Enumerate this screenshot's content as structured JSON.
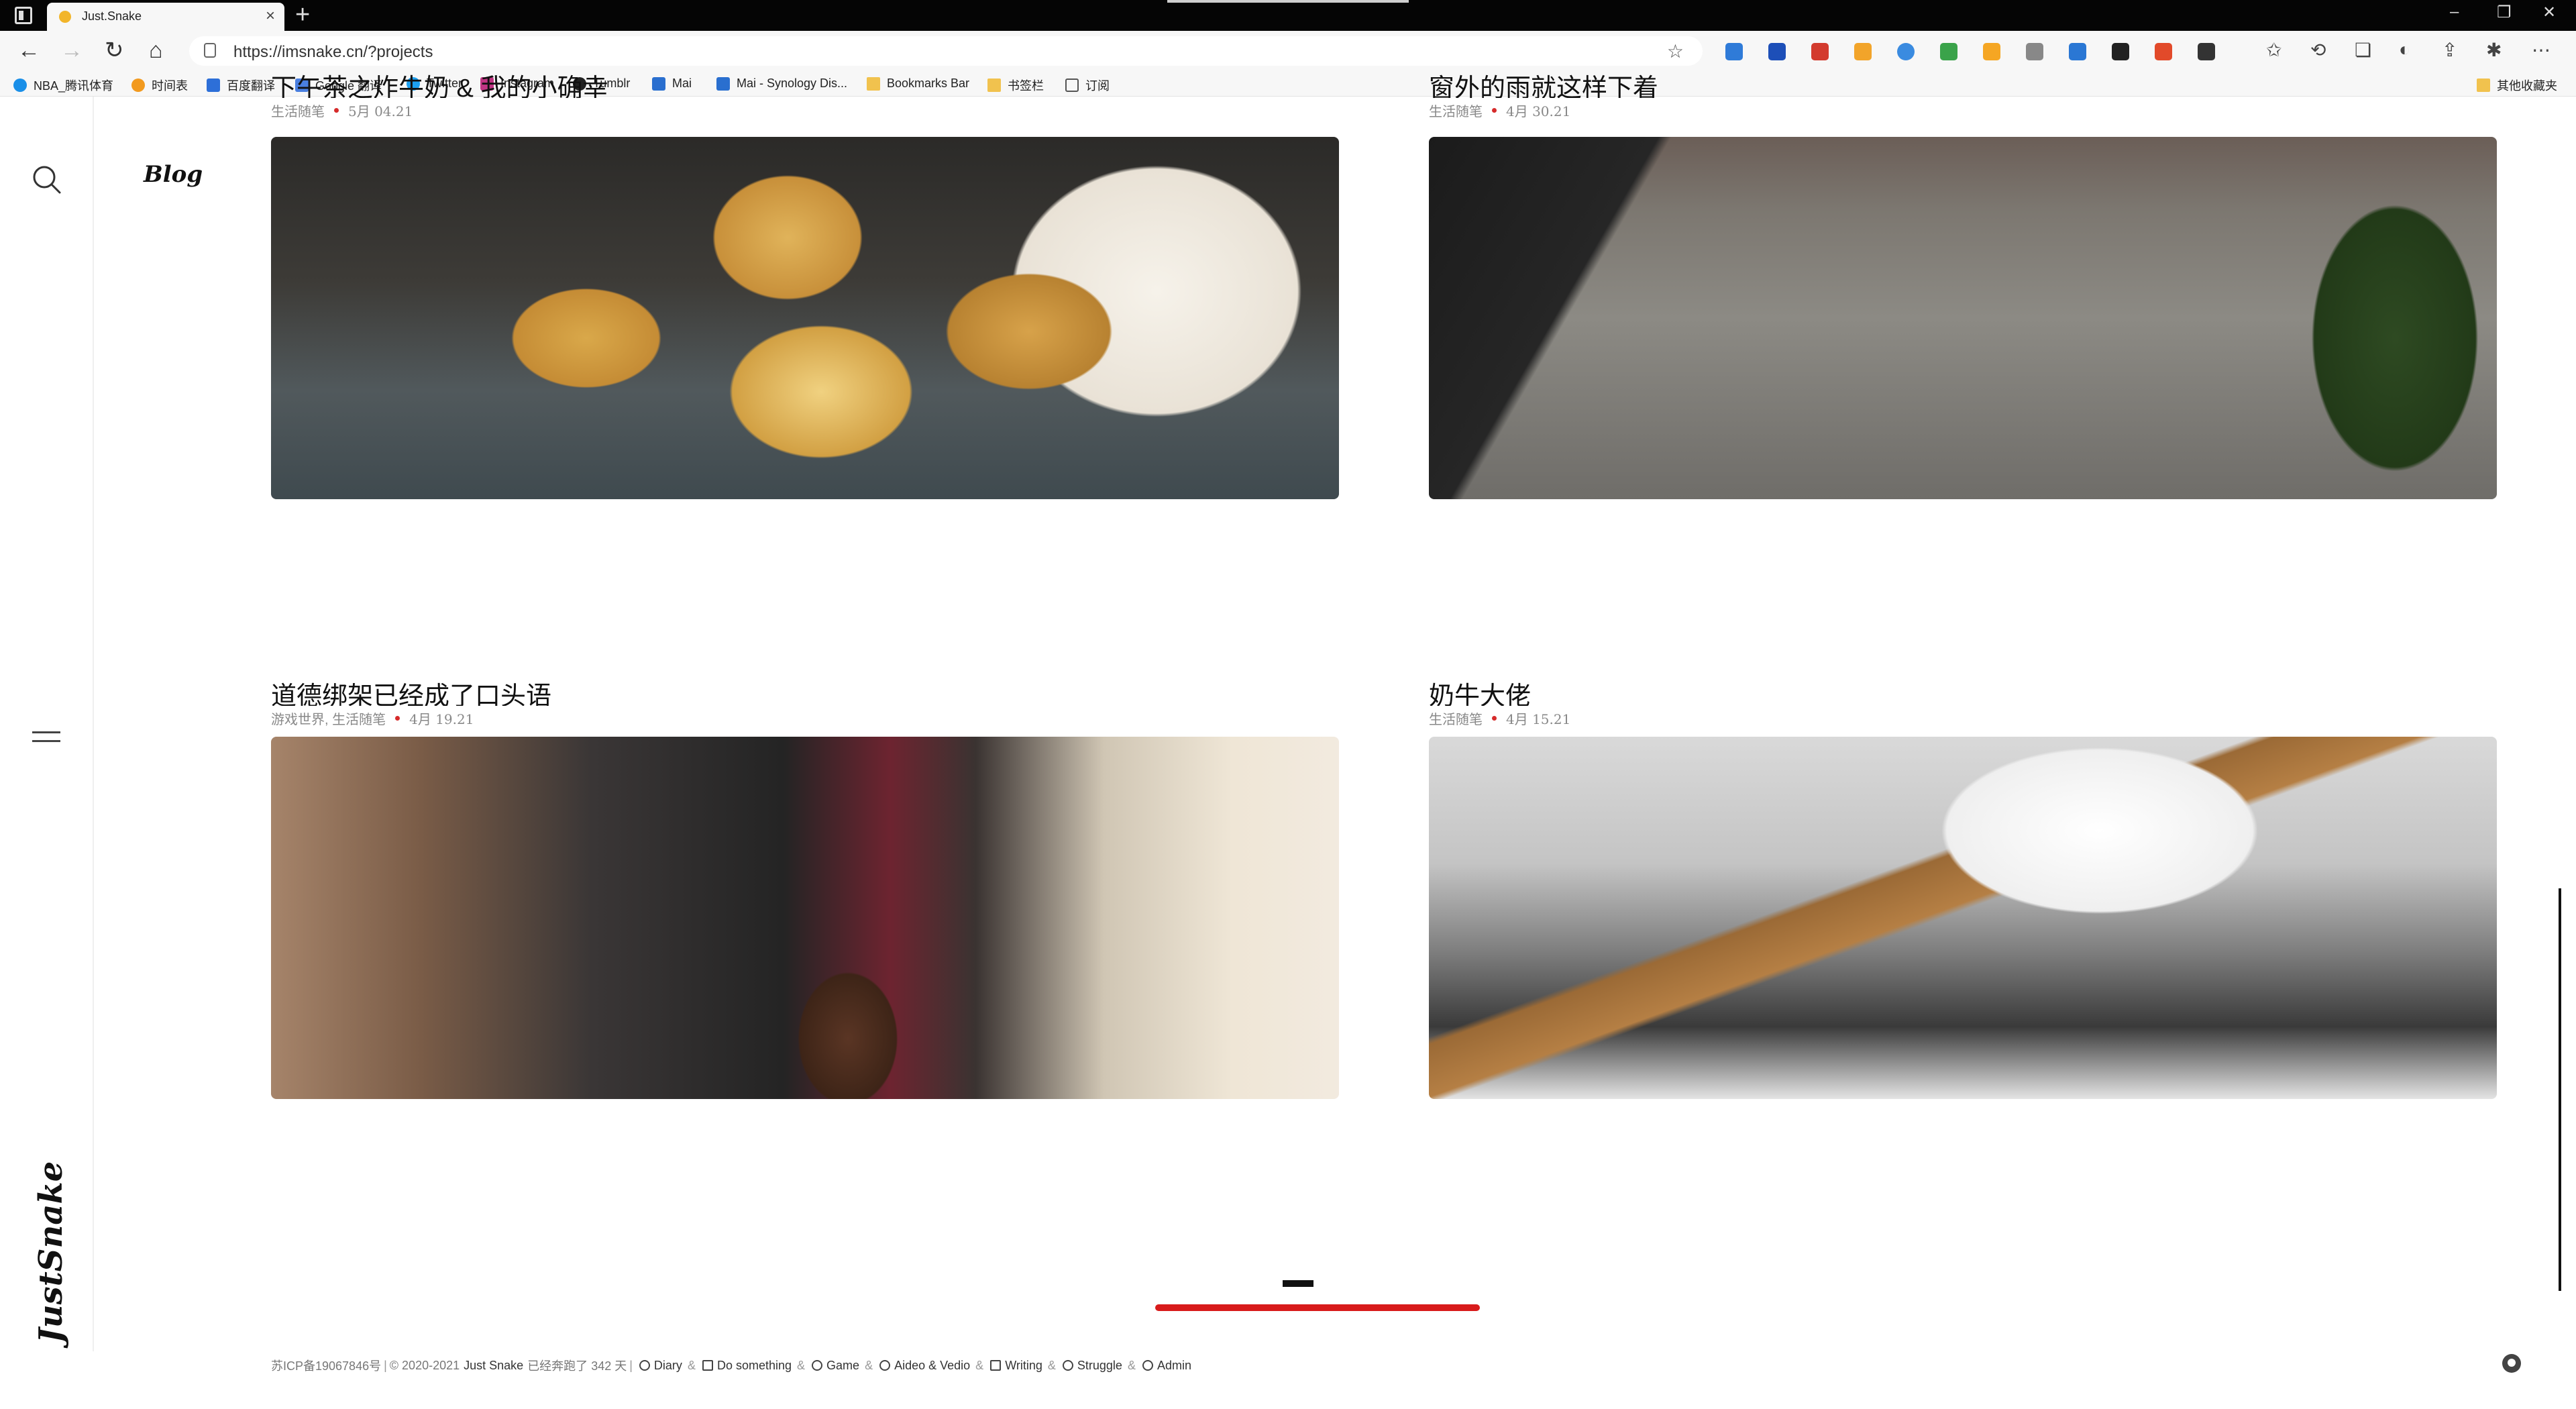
{
  "browser": {
    "tab_title": "Just.Snake",
    "tab_close": "×",
    "new_tab": "+",
    "url": "https://imsnake.cn/?projects",
    "window_controls": [
      "–",
      "❐",
      "✕"
    ],
    "bookmarks": [
      "NBA_腾讯体育",
      "时间表",
      "百度翻译",
      "Google 翻译",
      "Twitter",
      "Instagram",
      "Tumblr",
      "Mai",
      "Mai - Synology Dis...",
      "Bookmarks Bar",
      "书签栏",
      "订阅"
    ],
    "other_bookmarks": "其他收藏夹",
    "colors": {
      "tabbar": "#050505",
      "toolbar": "#f7f7f7"
    }
  },
  "site": {
    "section_label": "Blog",
    "logo_text": "JustSnake",
    "accent_color": "#d81b1b"
  },
  "posts": [
    {
      "title": "下午茶之炸牛奶 & 我的小确幸",
      "categories": "生活随笔",
      "date": "5月 04.21",
      "image": "fried-milk-photo"
    },
    {
      "title": "窗外的雨就这样下着",
      "categories": "生活随笔",
      "date": "4月 30.21",
      "image": "rain-courtyard-photo"
    },
    {
      "title": "道德绑架已经成了口头语",
      "categories": "游戏世界, 生活随笔",
      "date": "4月 19.21",
      "image": "bus-passengers-photo"
    },
    {
      "title": "奶牛大佬",
      "categories": "生活随笔",
      "date": "4月 15.21",
      "image": "cat-close-up-photo"
    }
  ],
  "footer": {
    "icp": "苏ICP备19067846号",
    "copyright": "© 2020-2021",
    "owner": "Just Snake",
    "uptime": "已经奔跑了 342 天",
    "links": [
      "Diary",
      "Do something",
      "Game",
      "Aideo & Vedio",
      "Writing",
      "Struggle",
      "Admin"
    ]
  }
}
